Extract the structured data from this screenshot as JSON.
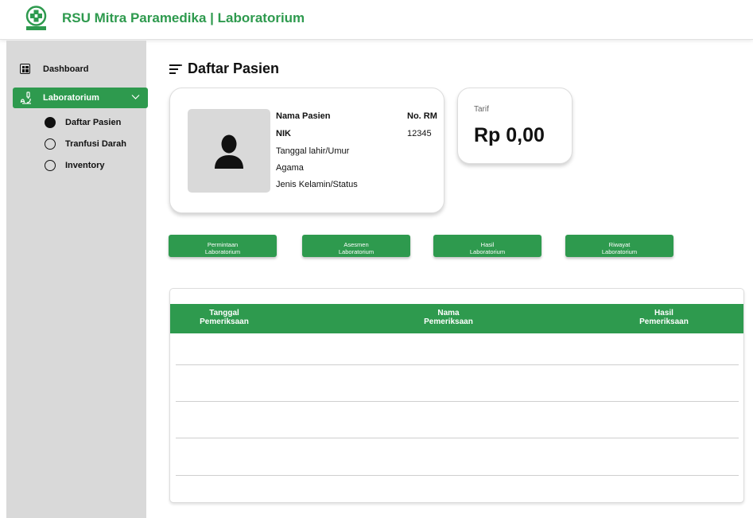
{
  "app": {
    "brand": "RSU Mitra Paramedika | Laboratorium"
  },
  "sidebar": {
    "dashboard": "Dashboard",
    "laboratorium": "Laboratorium",
    "sub_items": [
      "Daftar Pasien",
      "Tranfusi Darah",
      "Inventory"
    ]
  },
  "page": {
    "title": "Daftar Pasien"
  },
  "patient": {
    "name_label": "Nama Pasien",
    "nik_label": "NIK",
    "dob_label": "Tanggal lahir/Umur",
    "religion_label": "Agama",
    "gender_label": "Jenis Kelamin/Status",
    "rm_label": "No. RM",
    "rm_value": "12345"
  },
  "tarif": {
    "label": "Tarif",
    "value": "Rp 0,00"
  },
  "actions": [
    {
      "line1": "Permintaan",
      "line2": "Laboratorium"
    },
    {
      "line1": "Asesmen",
      "line2": "Laboratorium"
    },
    {
      "line1": "Hasil",
      "line2": "Laboratorium"
    },
    {
      "line1": "Riwayat",
      "line2": "Laboratorium"
    }
  ],
  "table": {
    "headers": [
      {
        "line1": "Tanggal",
        "line2": "Pemeriksaan"
      },
      {
        "line1": "Nama",
        "line2": "Pemeriksaan"
      },
      {
        "line1": "Hasil",
        "line2": "Pemeriksaan"
      }
    ]
  },
  "colors": {
    "accent": "#2e9a4e",
    "sidebar": "#d9d9d9"
  }
}
